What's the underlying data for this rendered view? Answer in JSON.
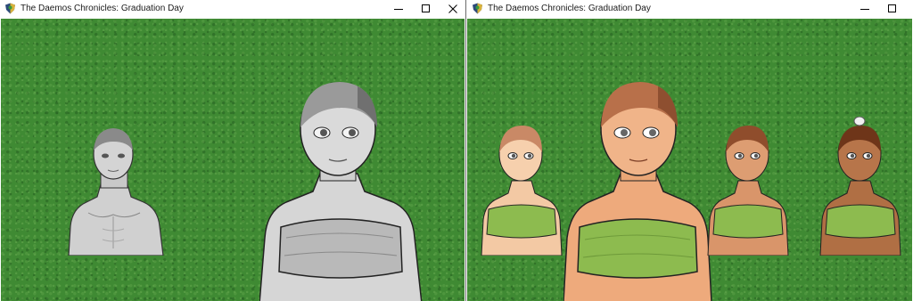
{
  "windows": [
    {
      "title": "The Daemos Chronicles: Graduation Day",
      "controls": [
        "minimize",
        "maximize",
        "close"
      ]
    },
    {
      "title": "The Daemos Chronicles: Graduation Day",
      "controls": [
        "minimize",
        "maximize"
      ]
    }
  ],
  "characters": {
    "left": [
      {
        "name": "male-body-base",
        "style": "greyscale"
      },
      {
        "name": "female-body-base",
        "style": "greyscale",
        "top": "bandeau"
      }
    ],
    "right": [
      {
        "name": "small-girl-light-skin",
        "skin": "#f3c9a4",
        "top": "green bandeau"
      },
      {
        "name": "large-girl-tan-skin",
        "skin": "#eeaa7c",
        "top": "green bandeau"
      },
      {
        "name": "small-girl-tan-skin",
        "skin": "#d9956a",
        "top": "green bandeau"
      },
      {
        "name": "small-girl-brown-skin",
        "skin": "#b06f44",
        "top": "green bandeau"
      }
    ]
  },
  "colors": {
    "grass": "#3f8a33",
    "bandeau": "#8dbb4f",
    "titlebar": "#ffffff"
  }
}
